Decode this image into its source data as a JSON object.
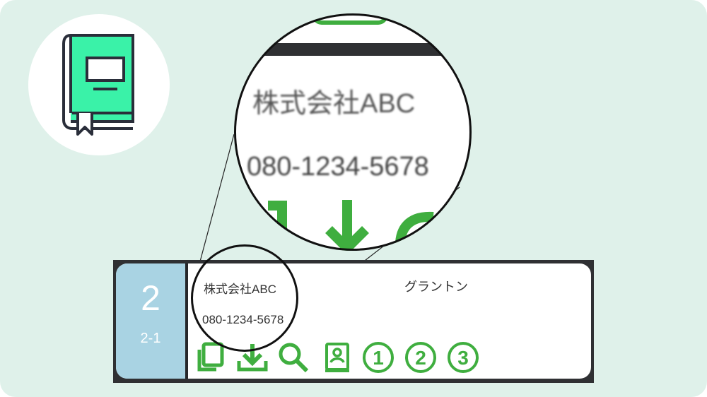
{
  "badge": {
    "icon": "book-icon",
    "accent": "#3af2a8"
  },
  "card": {
    "number": "2",
    "sub_number": "2-1",
    "company": "株式会社ABC",
    "contact_name": "グラントン",
    "phone": "080-1234-5678",
    "actions": [
      {
        "icon": "copy-icon"
      },
      {
        "icon": "download-icon"
      },
      {
        "icon": "search-icon"
      },
      {
        "icon": "contact-card-icon"
      },
      {
        "icon": "circled-number-icon",
        "label": "1"
      },
      {
        "icon": "circled-number-icon",
        "label": "2"
      },
      {
        "icon": "circled-number-icon",
        "label": "3"
      }
    ],
    "action_color": "#3fae3f",
    "number_panel_color": "#a9d3e3"
  },
  "magnifier": {
    "company": "株式会社ABC",
    "phone": "080-1234-5678"
  }
}
